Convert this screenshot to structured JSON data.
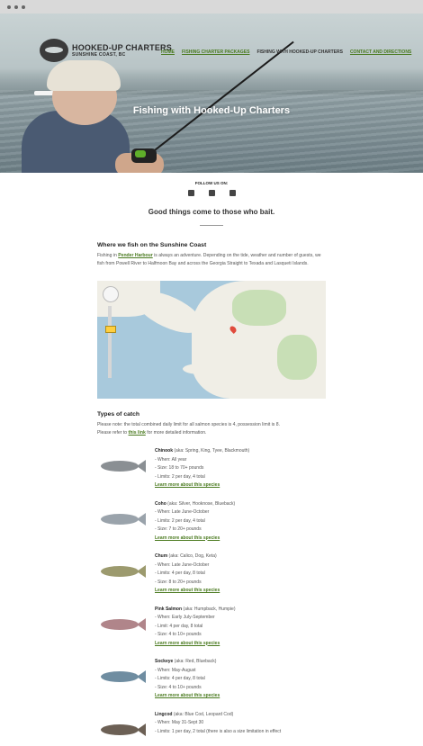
{
  "header": {
    "logo_line1": "HOOKED-UP CHARTERS",
    "logo_line2": "SUNSHINE COAST, BC",
    "nav": [
      "HOME",
      "FISHING CHARTER PACKAGES",
      "FISHING WITH HOOKED-UP CHARTERS",
      "CONTACT AND DIRECTIONS"
    ]
  },
  "hero": {
    "title": "Fishing with Hooked-Up Charters"
  },
  "follow": {
    "label": "FOLLOW US ON:",
    "icons": [
      "instagram-icon",
      "twitter-icon",
      "facebook-icon"
    ]
  },
  "tagline": "Good things come to those who bait.",
  "where": {
    "heading": "Where we fish on the Sunshine Coast",
    "intro_pre": "Fishing in ",
    "intro_link": "Pender Harbour",
    "intro_post": " is always an adventure. Depending on the tide, weather and number of guests, we fish from Powell River to Halfmoon Bay and across the Georgia Straight to Texada and Lasqueti Islands."
  },
  "catch": {
    "heading": "Types of catch",
    "note1": "Please note: the total combined daily limit for all salmon species is 4, possession limit is 8.",
    "note2_pre": "Please refer to ",
    "note2_link": "this link",
    "note2_post": " for more detailed information.",
    "fish": [
      {
        "name": "Chinook",
        "aka": " (aka: Spring, King, Tyee, Blackmouth)",
        "lines": [
          "- When: All year",
          "- Size: 18 to 70+ pounds",
          "- Limits: 2 per day, 4 total"
        ],
        "link": "Learn more about this species",
        "color": "#8a8f93"
      },
      {
        "name": "Coho",
        "aka": " (aka: Silver, Hooknose, Blueback)",
        "lines": [
          "- When: Late June-October",
          "- Limits: 2 per day, 4 total",
          "- Size: 7 to 20+ pounds"
        ],
        "link": "Learn more about this species",
        "color": "#9aa3ab"
      },
      {
        "name": "Chum",
        "aka": " (aka: Calico, Dog, Keta)",
        "lines": [
          "- When: Late June-October",
          "- Limits: 4 per day, 8 total",
          "- Size: 8 to 20+ pounds"
        ],
        "link": "Learn more about this species",
        "color": "#9c9a6e"
      },
      {
        "name": "Pink Salmon",
        "aka": " (aka: Humpback, Humpie)",
        "lines": [
          "- When: Early July-September",
          "- Limit: 4 per day, 8 total",
          "- Size: 4 to 10+ pounds"
        ],
        "link": "Learn more about this species",
        "color": "#b0858a"
      },
      {
        "name": "Sockeye",
        "aka": " (aka: Red, Blueback)",
        "lines": [
          "- When: May-August",
          "- Limits: 4 per day, 8 total",
          "- Size: 4 to 10+ pounds"
        ],
        "link": "Learn more about this species",
        "color": "#6f8da1"
      },
      {
        "name": "Lingcod",
        "aka": " (aka: Blue Cod, Leopard Cod)",
        "lines": [
          "- When: May 31-Sept 30",
          "- Limits: 1 per day, 2 total (there is also a size limitation in effect"
        ],
        "link": "",
        "color": "#6c6055"
      }
    ]
  },
  "colors": {
    "link": "#4a7a1f",
    "hero_title": "#ffffff"
  }
}
